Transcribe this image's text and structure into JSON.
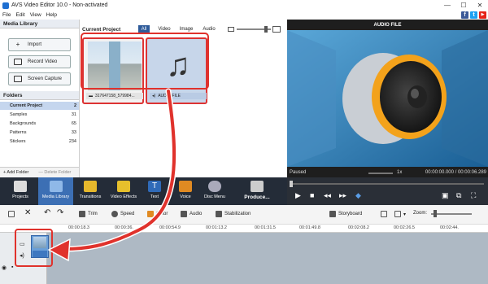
{
  "window": {
    "title": "AVS Video Editor 10.0 - Non-activated",
    "controls": [
      "—",
      "☐",
      "✕"
    ]
  },
  "menu": [
    "File",
    "Edit",
    "View",
    "Help"
  ],
  "social": [
    "f",
    "t",
    "▶"
  ],
  "media_library": {
    "header": "Media Library",
    "buttons": [
      "Import",
      "Record Video",
      "Screen Capture"
    ],
    "folders_header": "Folders",
    "folders": [
      {
        "name": "Current Project",
        "count": "2"
      },
      {
        "name": "Samples",
        "count": "31"
      },
      {
        "name": "Backgrounds",
        "count": "65"
      },
      {
        "name": "Patterns",
        "count": "33"
      },
      {
        "name": "Stickers",
        "count": "234"
      }
    ],
    "add_folder": "+ Add Folder",
    "delete_folder": "— Delete Folder"
  },
  "project": {
    "header": "Current Project",
    "tabs": [
      "All",
      "Video",
      "Image",
      "Audio"
    ],
    "items": [
      {
        "caption": "317647158_579984..."
      },
      {
        "caption": "AUDIO FILE"
      }
    ]
  },
  "preview": {
    "title": "AUDIO FILE",
    "status": "Paused",
    "speed": "1x",
    "time": "00:00:00.000 / 00:00:06.289"
  },
  "toolbar": [
    "Projects",
    "Media Library",
    "Transitions",
    "Video Effects",
    "Text",
    "Voice",
    "Disc Menu",
    "Produce..."
  ],
  "timeline_tools": {
    "trim": "Trim",
    "speed": "Speed",
    "color": "Color",
    "audio": "Audio",
    "stabilization": "Stabilization",
    "storyboard": "Storyboard",
    "zoom": "Zoom:"
  },
  "ruler": [
    "00:00:18.3",
    "00:00:36.",
    "00:00:54.9",
    "00:01:13.2",
    "00:01:31.5",
    "00:01:49.8",
    "00:02:08.2",
    "00:02:26.5",
    "00:02:44."
  ],
  "colors": {
    "accent": "#2e5b9a",
    "highlight": "#e0322c",
    "toolbar_bg": "#242c38"
  }
}
